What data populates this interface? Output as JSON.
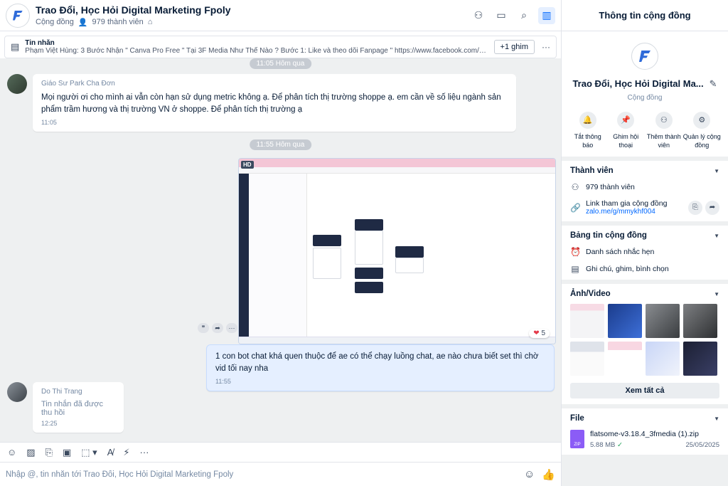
{
  "header": {
    "title": "Trao Đổi, Học Hỏi Digital Marketing Fpoly",
    "type": "Cộng đồng",
    "members": "979 thành viên",
    "logo_text": "3F MEDIA"
  },
  "pinned": {
    "label": "Tin nhắn",
    "text": "Phạm Việt Hùng: 3 Bước Nhận \" Canva Pro Free \" Tại 3F Media Như Thế Nào ? Bước 1: Like và theo dõi Fanpage \" https://www.facebook.com/3fmedia.official/  \" Bư...",
    "more_label": "+1 ghim"
  },
  "messages": {
    "chip1": "11:05 Hôm qua",
    "chip2": "11:55 Hôm qua",
    "m1": {
      "sender": "Giáo Sư Park Cha Đơn",
      "body": "Mọi người ơi cho mình ai vẫn còn hạn sử dụng metric không ạ. Để phân tích thị trường shoppe ạ. em cần về số liệu ngành sản phẩm trầm hương và thị trường VN ở shoppe. Để phân tích thị trường ạ",
      "time": "11:05"
    },
    "image": {
      "hd": "HD",
      "reaction_count": "5"
    },
    "m2": {
      "body": "1 con bot chat khá quen thuộc để ae có thể chạy luồng chat, ae nào chưa biết set thì chờ vid tối nay nha",
      "time": "11:55"
    },
    "m3": {
      "sender": "Do Thi Trang",
      "body": "Tin nhắn đã được thu hồi",
      "time": "12:25"
    }
  },
  "composer": {
    "placeholder": "Nhập @, tin nhắn tới Trao Đổi, Học Hỏi Digital Marketing Fpoly"
  },
  "info": {
    "title": "Thông tin cộng đồng",
    "group_name": "Trao Đổi, Học Hỏi Digital Ma...",
    "group_type": "Cộng đồng",
    "actions": [
      {
        "label": "Tắt thông báo",
        "icon": "bell-icon"
      },
      {
        "label": "Ghim hội thoại",
        "icon": "pin-icon"
      },
      {
        "label": "Thêm thành viên",
        "icon": "add-member-icon"
      },
      {
        "label": "Quản lý cộng đồng",
        "icon": "gear-icon"
      }
    ],
    "members_section": {
      "title": "Thành viên",
      "count": "979 thành viên",
      "link_label": "Link tham gia cộng đồng",
      "link": "zalo.me/g/mmykhf004"
    },
    "board_section": {
      "title": "Bảng tin cộng đồng",
      "reminders": "Danh sách nhắc hẹn",
      "notes": "Ghi chú, ghim, bình chọn"
    },
    "media_section": {
      "title": "Ảnh/Video",
      "see_all": "Xem tất cả"
    },
    "file_section": {
      "title": "File",
      "file_name": "flatsome-v3.18.4_3fmedia (1).zip",
      "file_size": "5.88 MB",
      "file_date": "25/05/2025",
      "file_ext": "ZIP"
    }
  },
  "colors": {
    "accent": "#0068ff",
    "chat_bg": "#eef0f1",
    "my_bubble": "#e5efff"
  }
}
